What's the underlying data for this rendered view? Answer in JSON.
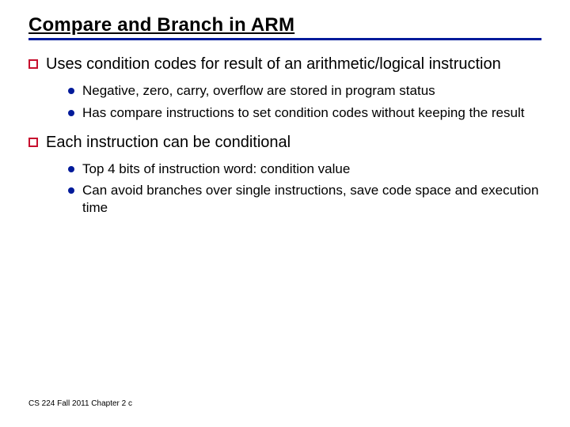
{
  "title": "Compare and Branch in ARM",
  "points": [
    {
      "text": "Uses condition codes for result of an arithmetic/logical instruction",
      "subs": [
        "Negative, zero, carry, overflow are stored in program status",
        "Has compare instructions to set condition codes without keeping the result"
      ]
    },
    {
      "text": "Each instruction can be conditional",
      "subs": [
        "Top 4 bits of instruction word: condition value",
        "Can avoid branches over single instructions, save code space and execution time"
      ]
    }
  ],
  "footer": "CS 224 Fall 2011 Chapter 2 c"
}
